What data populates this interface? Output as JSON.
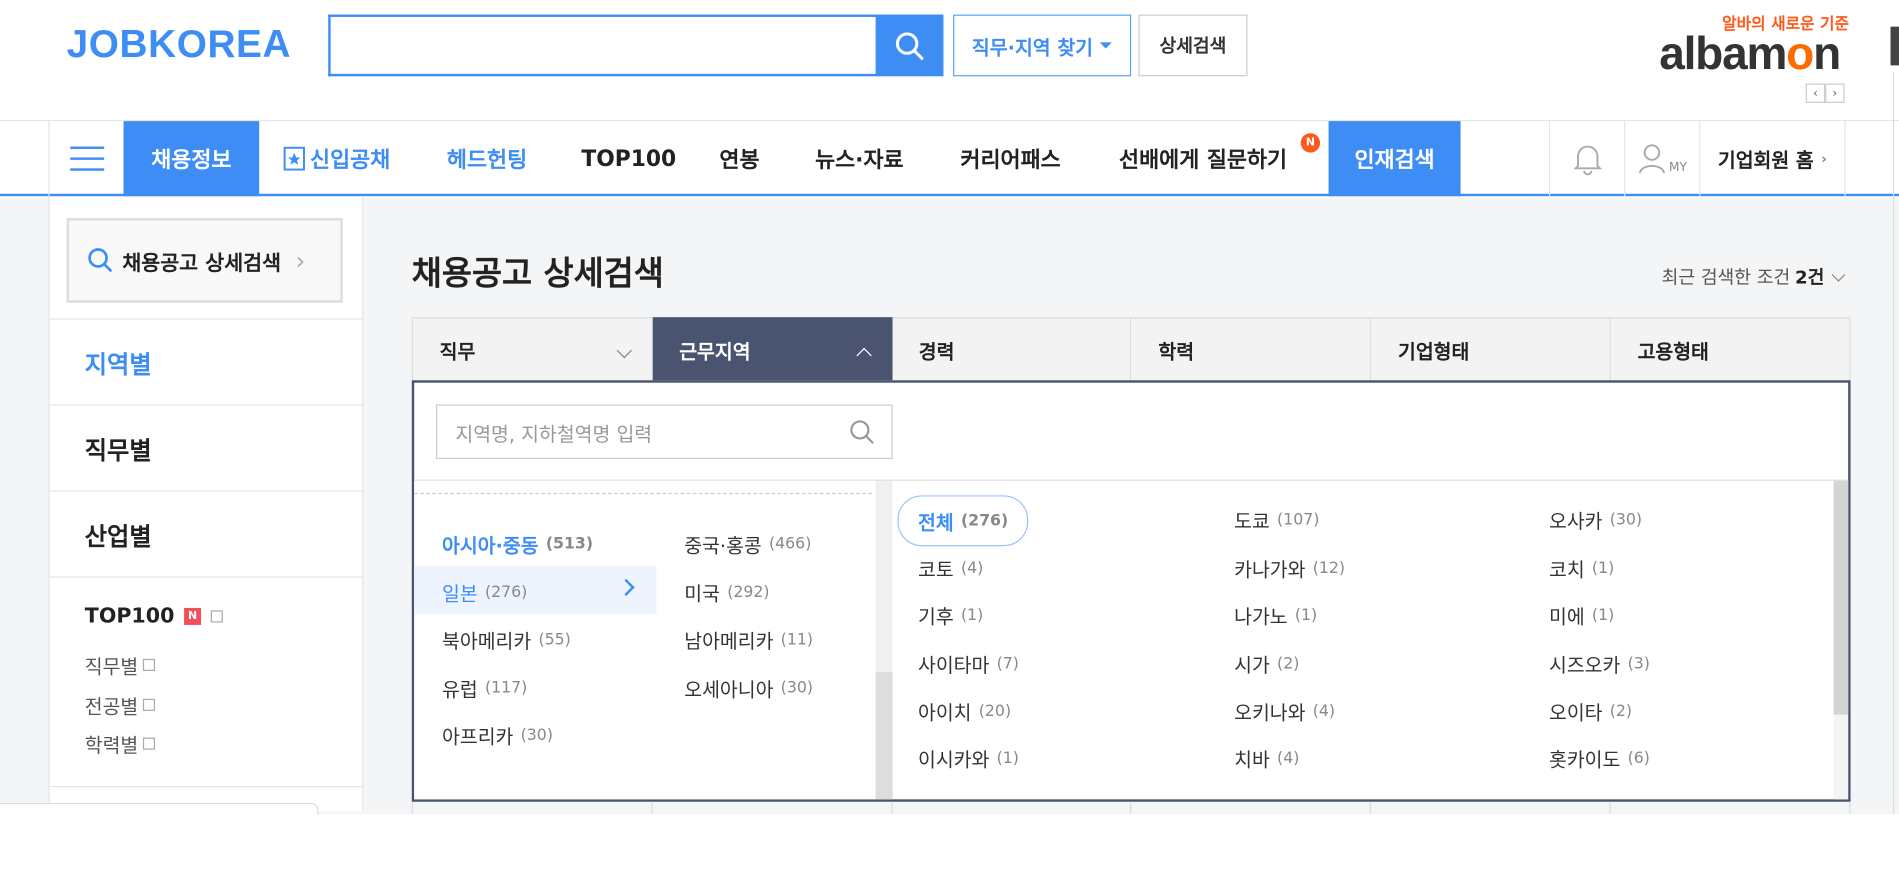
{
  "header": {
    "logo": "JOBKOREA",
    "search_placeholder": "",
    "job_region_button": "직무·지역 찾기",
    "detail_search_button": "상세검색",
    "albamon_tagline": "알바의 새로운 기준",
    "albamon_logo_pre": "albam",
    "albamon_logo_o": "o",
    "albamon_logo_post": "n"
  },
  "gnb": {
    "items": [
      "채용정보",
      "신입공채",
      "헤드헌팅",
      "TOP100",
      "연봉",
      "뉴스·자료",
      "커리어패스",
      "선배에게 질문하기",
      "인재검색"
    ],
    "new_badge": "N",
    "corp_home": "기업회원 홈",
    "my_label": "MY"
  },
  "sidebar": {
    "search_label": "채용공고 상세검색",
    "menus": [
      "지역별",
      "직무별",
      "산업별"
    ],
    "top100": "TOP100",
    "top100_badge": "N",
    "sub_items": [
      "직무별",
      "전공별",
      "학력별"
    ]
  },
  "main": {
    "title": "채용공고 상세검색",
    "recent_label": "최근 검색한 조건",
    "recent_count": "2건",
    "tabs": [
      "직무",
      "근무지역",
      "경력",
      "학력",
      "기업형태",
      "고용형태"
    ],
    "region_placeholder": "지역명, 지하철역명 입력",
    "continents": [
      {
        "name": "아시아·중동",
        "count": "(513)"
      },
      {
        "name": "일본",
        "count": "(276)"
      },
      {
        "name": "북아메리카",
        "count": "(55)"
      },
      {
        "name": "유럽",
        "count": "(117)"
      },
      {
        "name": "아프리카",
        "count": "(30)"
      },
      {
        "name": "중국·홍콩",
        "count": "(466)"
      },
      {
        "name": "미국",
        "count": "(292)"
      },
      {
        "name": "남아메리카",
        "count": "(11)"
      },
      {
        "name": "오세아니아",
        "count": "(30)"
      }
    ],
    "cities": [
      {
        "name": "전체",
        "count": "(276)"
      },
      {
        "name": "도쿄",
        "count": "(107)"
      },
      {
        "name": "오사카",
        "count": "(30)"
      },
      {
        "name": "코토",
        "count": "(4)"
      },
      {
        "name": "카나가와",
        "count": "(12)"
      },
      {
        "name": "코치",
        "count": "(1)"
      },
      {
        "name": "기후",
        "count": "(1)"
      },
      {
        "name": "나가노",
        "count": "(1)"
      },
      {
        "name": "미에",
        "count": "(1)"
      },
      {
        "name": "사이타마",
        "count": "(7)"
      },
      {
        "name": "시가",
        "count": "(2)"
      },
      {
        "name": "시즈오카",
        "count": "(3)"
      },
      {
        "name": "아이치",
        "count": "(20)"
      },
      {
        "name": "오키나와",
        "count": "(4)"
      },
      {
        "name": "오이타",
        "count": "(2)"
      },
      {
        "name": "이시카와",
        "count": "(1)"
      },
      {
        "name": "치바",
        "count": "(4)"
      },
      {
        "name": "홋카이도",
        "count": "(6)"
      }
    ]
  },
  "colors": {
    "brand_blue": "#3d8df5",
    "tab_active": "#4a5470",
    "badge_orange": "#ff5a1a"
  }
}
